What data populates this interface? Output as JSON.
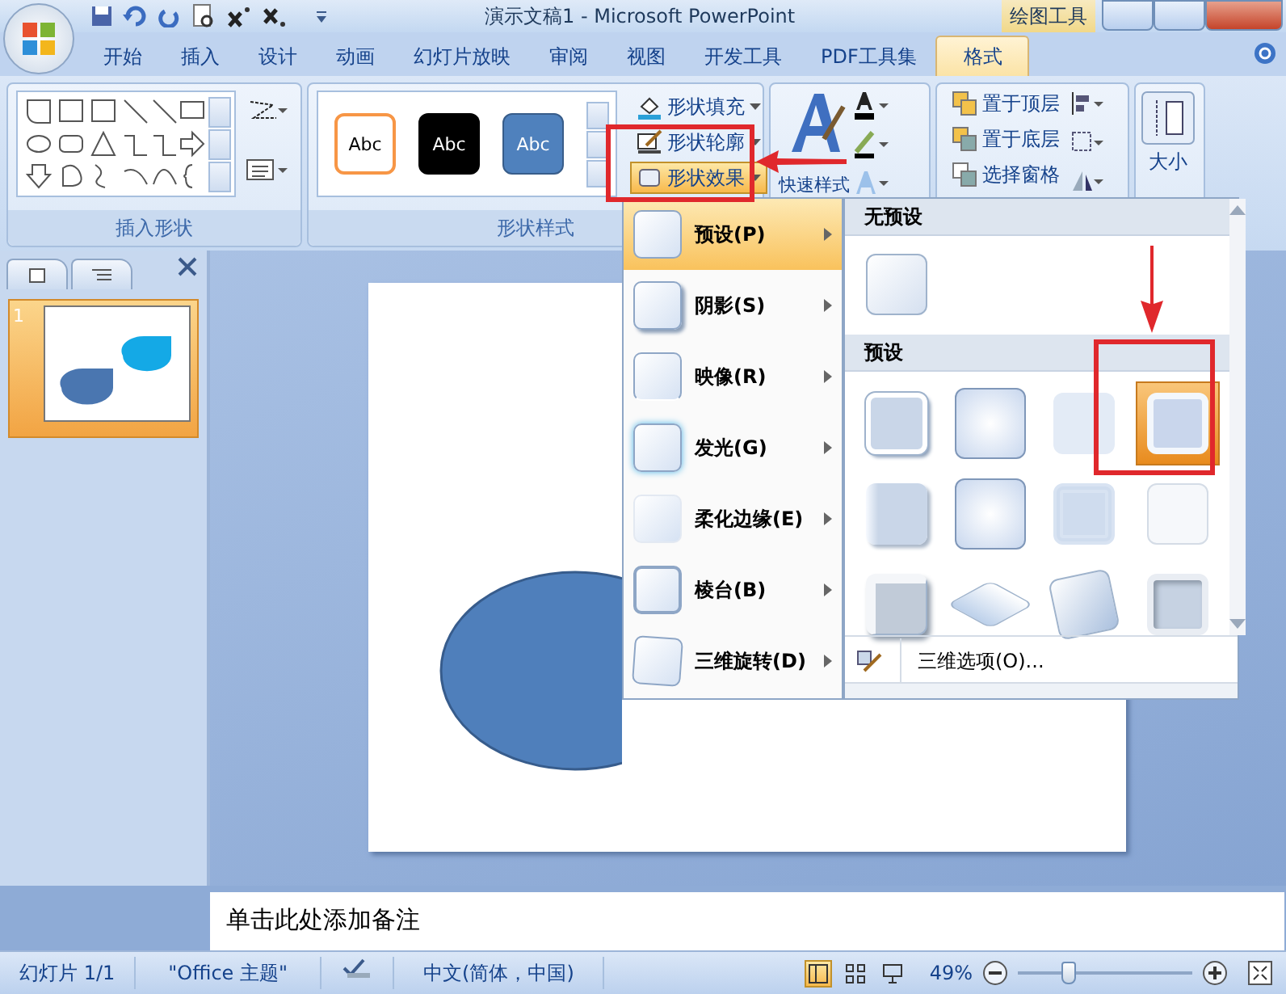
{
  "window": {
    "title": "演示文稿1 - Microsoft PowerPoint",
    "context_label": "绘图工具"
  },
  "tabs": [
    {
      "label": "开始",
      "selected": false
    },
    {
      "label": "插入",
      "selected": false
    },
    {
      "label": "设计",
      "selected": false
    },
    {
      "label": "动画",
      "selected": false
    },
    {
      "label": "幻灯片放映",
      "selected": false
    },
    {
      "label": "审阅",
      "selected": false
    },
    {
      "label": "视图",
      "selected": false
    },
    {
      "label": "开发工具",
      "selected": false
    },
    {
      "label": "PDF工具集",
      "selected": false
    },
    {
      "label": "格式",
      "selected": true
    }
  ],
  "ribbon": {
    "insert_shapes": {
      "label": "插入形状"
    },
    "shape_styles": {
      "label": "形状样式",
      "gallery": [
        {
          "label": "Abc",
          "kind": "outline"
        },
        {
          "label": "Abc",
          "kind": "dark"
        },
        {
          "label": "Abc",
          "kind": "filled"
        }
      ],
      "commands": [
        {
          "label": "形状填充",
          "selected": false
        },
        {
          "label": "形状轮廓",
          "selected": false
        },
        {
          "label": "形状效果",
          "selected": true
        }
      ]
    },
    "wordart": {
      "quick_styles": "快速样式"
    },
    "arrange": [
      "置于顶层",
      "置于底层",
      "选择窗格"
    ],
    "size": "大小"
  },
  "slides_panel": {
    "slides": [
      {
        "number": "1",
        "selected": true
      }
    ]
  },
  "effects_menu": {
    "items": [
      {
        "label": "预设(P)",
        "selected": true
      },
      {
        "label": "阴影(S)",
        "selected": false
      },
      {
        "label": "映像(R)",
        "selected": false
      },
      {
        "label": "发光(G)",
        "selected": false
      },
      {
        "label": "柔化边缘(E)",
        "selected": false
      },
      {
        "label": "棱台(B)",
        "selected": false
      },
      {
        "label": "三维旋转(D)",
        "selected": false
      }
    ],
    "submenu": {
      "sections": [
        {
          "title": "无预设",
          "tiles": [
            {
              "kind": "plain",
              "selected": false
            }
          ]
        },
        {
          "title": "预设",
          "tiles": [
            {
              "kind": "raised",
              "selected": false
            },
            {
              "kind": "pillow",
              "selected": false
            },
            {
              "kind": "faded",
              "selected": false
            },
            {
              "kind": "frame",
              "selected": true
            },
            {
              "kind": "side",
              "selected": false
            },
            {
              "kind": "pillow",
              "selected": false
            },
            {
              "kind": "ring",
              "selected": false
            },
            {
              "kind": "blank",
              "selected": false
            },
            {
              "kind": "cube",
              "selected": false
            },
            {
              "kind": "tilt",
              "selected": false
            },
            {
              "kind": "slant",
              "selected": false
            },
            {
              "kind": "deep",
              "selected": false
            }
          ]
        }
      ],
      "footer": "三维选项(O)..."
    }
  },
  "notes": {
    "placeholder": "单击此处添加备注"
  },
  "status_bar": {
    "slide": "幻灯片 1/1",
    "theme": "\"Office 主题\"",
    "language": "中文(简体，中国)",
    "views": [
      {
        "selected": true
      },
      {
        "selected": false
      },
      {
        "selected": false
      }
    ],
    "zoom": "49%",
    "zoom_slider": {
      "level": 0.25
    }
  }
}
